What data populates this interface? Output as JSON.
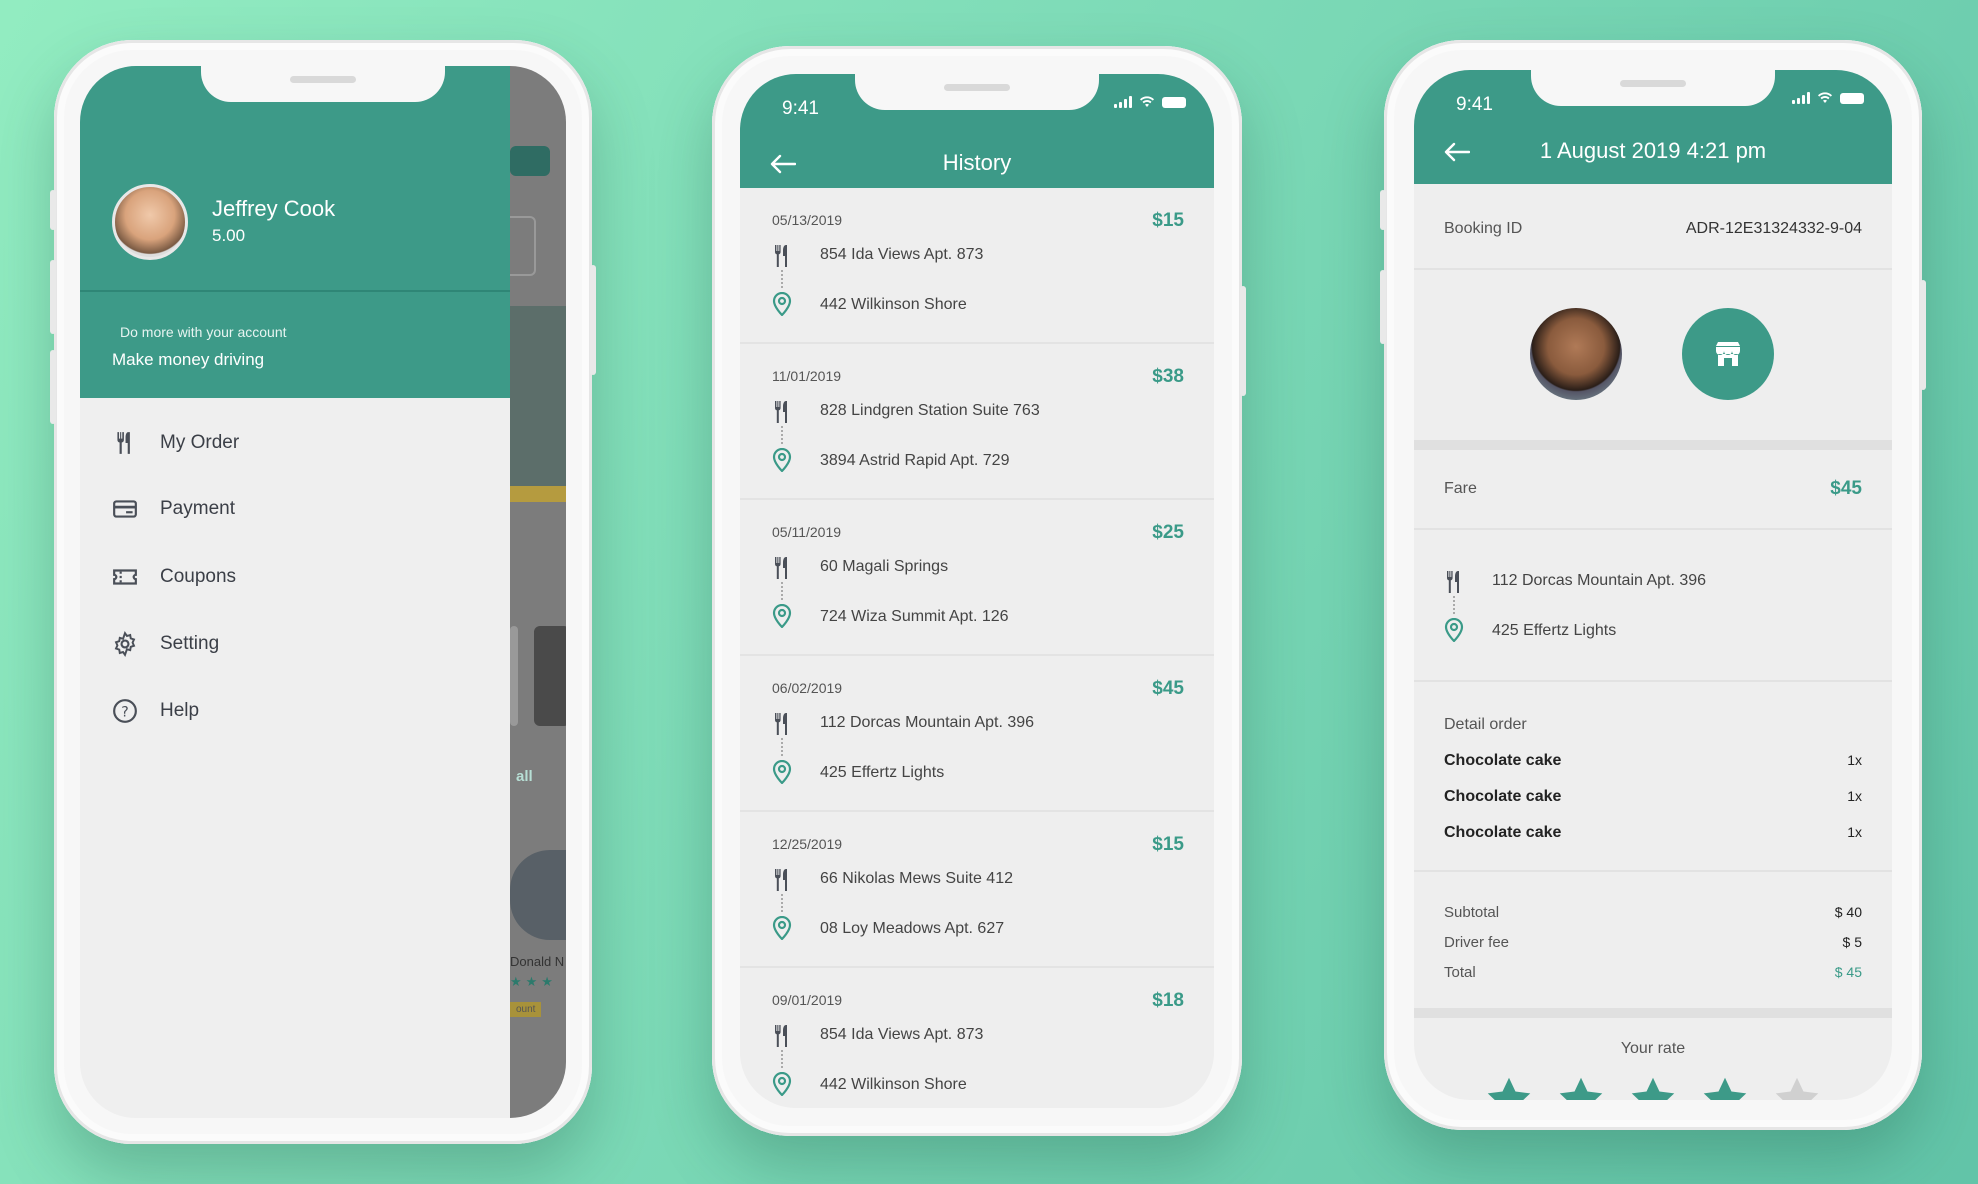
{
  "colors": {
    "accent": "#3d9a88",
    "background": "#7fdcb8",
    "star_empty": "#d0d0d0"
  },
  "drawer": {
    "user_name": "Jeffrey Cook",
    "user_rating": "5.00",
    "promo_small": "Do more with your account",
    "promo_big": "Make money driving",
    "menu": [
      {
        "label": "My Order",
        "icon": "fork-knife-icon"
      },
      {
        "label": "Payment",
        "icon": "credit-card-icon"
      },
      {
        "label": "Coupons",
        "icon": "coupon-icon"
      },
      {
        "label": "Setting",
        "icon": "gear-icon"
      },
      {
        "label": "Help",
        "icon": "help-icon"
      }
    ],
    "behind": {
      "link": "all",
      "name_snippet": "Donald N",
      "badge": "ount"
    }
  },
  "history": {
    "time": "9:41",
    "title": "History",
    "items": [
      {
        "date": "05/13/2019",
        "price": "$15",
        "from": "854 Ida Views Apt. 873",
        "to": "442 Wilkinson Shore"
      },
      {
        "date": "11/01/2019",
        "price": "$38",
        "from": "828 Lindgren Station Suite 763",
        "to": "3894 Astrid Rapid Apt. 729"
      },
      {
        "date": "05/11/2019",
        "price": "$25",
        "from": "60 Magali Springs",
        "to": "724 Wiza Summit Apt. 126"
      },
      {
        "date": "06/02/2019",
        "price": "$45",
        "from": "112 Dorcas Mountain Apt. 396",
        "to": "425 Effertz Lights"
      },
      {
        "date": "12/25/2019",
        "price": "$15",
        "from": "66 Nikolas Mews Suite 412",
        "to": "08 Loy Meadows Apt. 627"
      },
      {
        "date": "09/01/2019",
        "price": "$18",
        "from": "854 Ida Views Apt. 873",
        "to": "442 Wilkinson Shore"
      }
    ]
  },
  "detail": {
    "time": "9:41",
    "title": "1 August 2019 4:21 pm",
    "booking_label": "Booking ID",
    "booking_id": "ADR-12E31324332-9-04",
    "fare_label": "Fare",
    "fare_value": "$45",
    "from": "112 Dorcas Mountain Apt. 396",
    "to": "425 Effertz Lights",
    "detail_label": "Detail order",
    "items": [
      {
        "name": "Chocolate cake",
        "qty": "1x"
      },
      {
        "name": "Chocolate cake",
        "qty": "1x"
      },
      {
        "name": "Chocolate cake",
        "qty": "1x"
      }
    ],
    "subtotal_label": "Subtotal",
    "subtotal": "$ 40",
    "driver_fee_label": "Driver fee",
    "driver_fee": "$ 5",
    "total_label": "Total",
    "total": "$ 45",
    "rate_label": "Your rate",
    "rating": 4,
    "rating_max": 5
  }
}
